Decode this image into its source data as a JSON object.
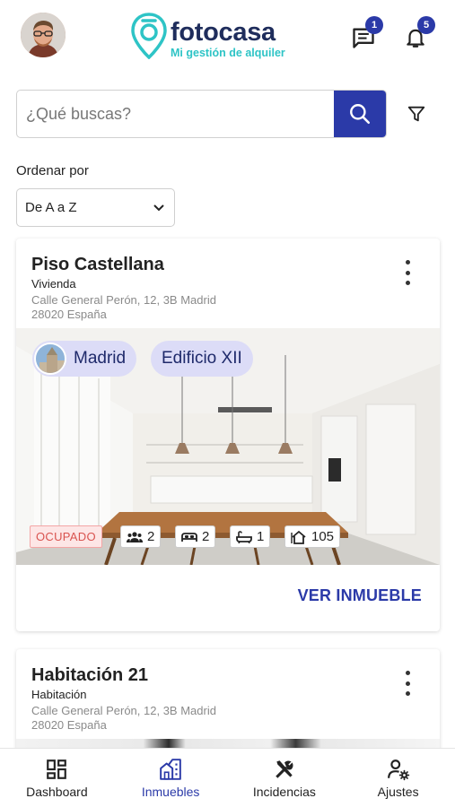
{
  "header": {
    "logo_name": "fotocasa",
    "logo_tagline": "Mi gestión de alquiler",
    "messages_badge": "1",
    "notifications_badge": "5",
    "colors": {
      "brand_blue": "#2b3aa8",
      "teal": "#2ec4c6",
      "navy": "#1f2d5c"
    }
  },
  "search": {
    "placeholder": "¿Qué buscas?",
    "value": ""
  },
  "sort": {
    "label": "Ordenar por",
    "selected": "De A a Z"
  },
  "cards": [
    {
      "title": "Piso Castellana",
      "type": "Vivienda",
      "address_line1": "Calle General Perón, 12, 3B Madrid",
      "address_line2": "28020 España",
      "chips": [
        "Madrid",
        "Edificio XII"
      ],
      "status": "OCUPADO",
      "stats": {
        "people": "2",
        "bedrooms": "2",
        "bathrooms": "1",
        "area": "105"
      },
      "action": "VER INMUEBLE"
    },
    {
      "title": "Habitación 21",
      "type": "Habitación",
      "address_line1": "Calle General Perón, 12, 3B Madrid",
      "address_line2": "28020 España"
    }
  ],
  "bottom_nav": {
    "items": [
      {
        "label": "Dashboard",
        "icon": "dashboard-icon"
      },
      {
        "label": "Inmuebles",
        "icon": "building-icon",
        "active": true
      },
      {
        "label": "Incidencias",
        "icon": "tools-icon"
      },
      {
        "label": "Ajustes",
        "icon": "user-settings-icon"
      }
    ]
  }
}
